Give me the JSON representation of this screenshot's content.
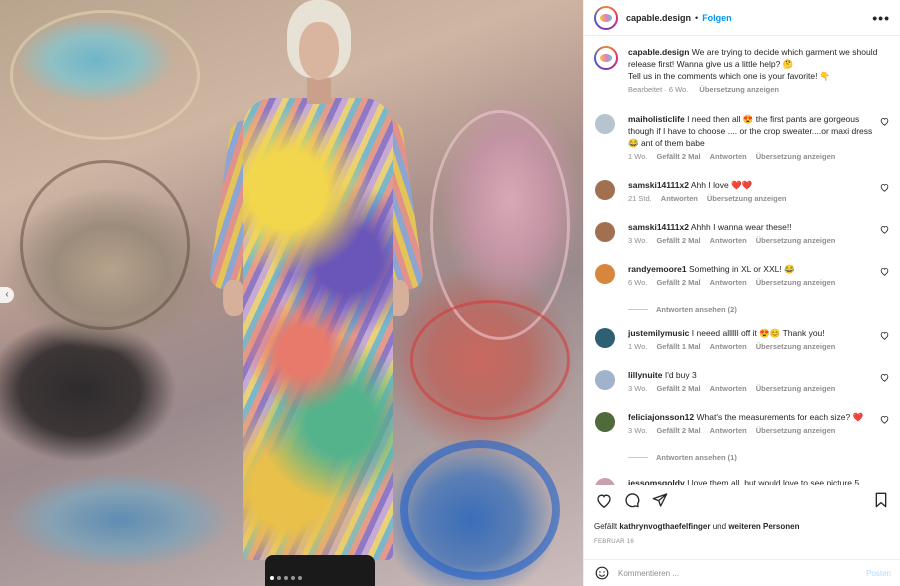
{
  "post": {
    "username": "capable.design",
    "separator": "•",
    "follow_label": "Folgen",
    "more_label": "•••",
    "caption_user": "capable.design",
    "caption_text": "We are trying to decide which garment we should release first! Wanna give us a little help? 🤔",
    "caption_text2": "Tell us in the comments which one is your favorite! 👇",
    "caption_meta": {
      "edited": "Bearbeitet · 6 Wo.",
      "translate": "Übersetzung anzeigen"
    }
  },
  "comments": [
    {
      "user": "maiholisticlife",
      "text": "I need then all 😍 the first pants are gorgeous though if I have to choose .... or the crop sweater....or maxi dress 😂 ant of them babe",
      "time": "1 Wo.",
      "likes": "Gefällt 2 Mal",
      "reply": "Antworten",
      "translate": "Übersetzung anzeigen",
      "color": "#b7c3cf"
    },
    {
      "user": "samski14111x2",
      "text": "Ahh I love ❤️❤️",
      "time": "21 Std.",
      "likes": "",
      "reply": "Antworten",
      "translate": "Übersetzung anzeigen",
      "color": "#a07050"
    },
    {
      "user": "samski14111x2",
      "text": "Ahhh I wanna wear these!!",
      "time": "3 Wo.",
      "likes": "Gefällt 2 Mal",
      "reply": "Antworten",
      "translate": "Übersetzung anzeigen",
      "color": "#a07050"
    },
    {
      "user": "randyemoore1",
      "text": "Something in XL or XXL! 😂",
      "time": "6 Wo.",
      "likes": "Gefällt 2 Mal",
      "reply": "Antworten",
      "translate": "Übersetzung anzeigen",
      "color": "#d7873b",
      "replies": "Antworten ansehen (2)"
    },
    {
      "user": "justemilymusic",
      "text": "I neeed allllll off it 😍😊 Thank you!",
      "time": "1 Wo.",
      "likes": "Gefällt 1 Mal",
      "reply": "Antworten",
      "translate": "Übersetzung anzeigen",
      "color": "#2f5f72"
    },
    {
      "user": "lillynuite",
      "text": "I'd buy 3",
      "time": "3 Wo.",
      "likes": "Gefällt 2 Mal",
      "reply": "Antworten",
      "translate": "Übersetzung anzeigen",
      "color": "#9fb3cc"
    },
    {
      "user": "feliciajonsson12",
      "text": "What's the measurements for each size? ❤️",
      "time": "3 Wo.",
      "likes": "Gefällt 2 Mal",
      "reply": "Antworten",
      "translate": "Übersetzung anzeigen",
      "color": "#4f6b3c",
      "replies": "Antworten ansehen (1)"
    },
    {
      "user": "jessomsgoldy",
      "text": "I love them all, but would love to see picture 5",
      "time": "",
      "likes": "",
      "reply": "",
      "translate": "",
      "color": "#c9a0b0"
    }
  ],
  "footer": {
    "likes_prefix": "Gefällt",
    "likes_user": "kathrynvogthaefelfinger",
    "likes_mid": "und",
    "likes_more": "weiteren Personen",
    "date": "FEBRUAR 16",
    "comment_placeholder": "Kommentieren ...",
    "post_label": "Posten"
  },
  "media": {
    "prev_label": "‹",
    "slides": 5,
    "active_slide": 1
  }
}
